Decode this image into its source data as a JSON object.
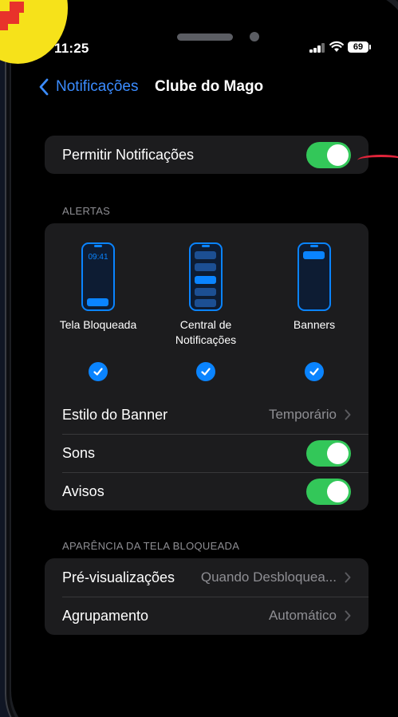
{
  "status_bar": {
    "time": "11:25",
    "battery": "69"
  },
  "nav": {
    "back_label": "Notificações",
    "title": "Clube do Mago"
  },
  "allow_notifications": {
    "label": "Permitir Notificações",
    "enabled": true
  },
  "alerts": {
    "header": "ALERTAS",
    "options": [
      {
        "label": "Tela Bloqueada",
        "mock_time": "09:41",
        "checked": true
      },
      {
        "label": "Central de Notificações",
        "checked": true
      },
      {
        "label": "Banners",
        "checked": true
      }
    ],
    "banner_style": {
      "label": "Estilo do Banner",
      "value": "Temporário"
    },
    "sounds": {
      "label": "Sons",
      "enabled": true
    },
    "badges": {
      "label": "Avisos",
      "enabled": true
    }
  },
  "lock_screen": {
    "header": "APARÊNCIA DA TELA BLOQUEADA",
    "previews": {
      "label": "Pré-visualizações",
      "value": "Quando Desbloquea..."
    },
    "grouping": {
      "label": "Agrupamento",
      "value": "Automático"
    }
  },
  "colors": {
    "accent": "#0a84ff",
    "toggle_on": "#33c759",
    "group_bg": "#1c1c1e",
    "secondary_text": "#8e8e93"
  }
}
